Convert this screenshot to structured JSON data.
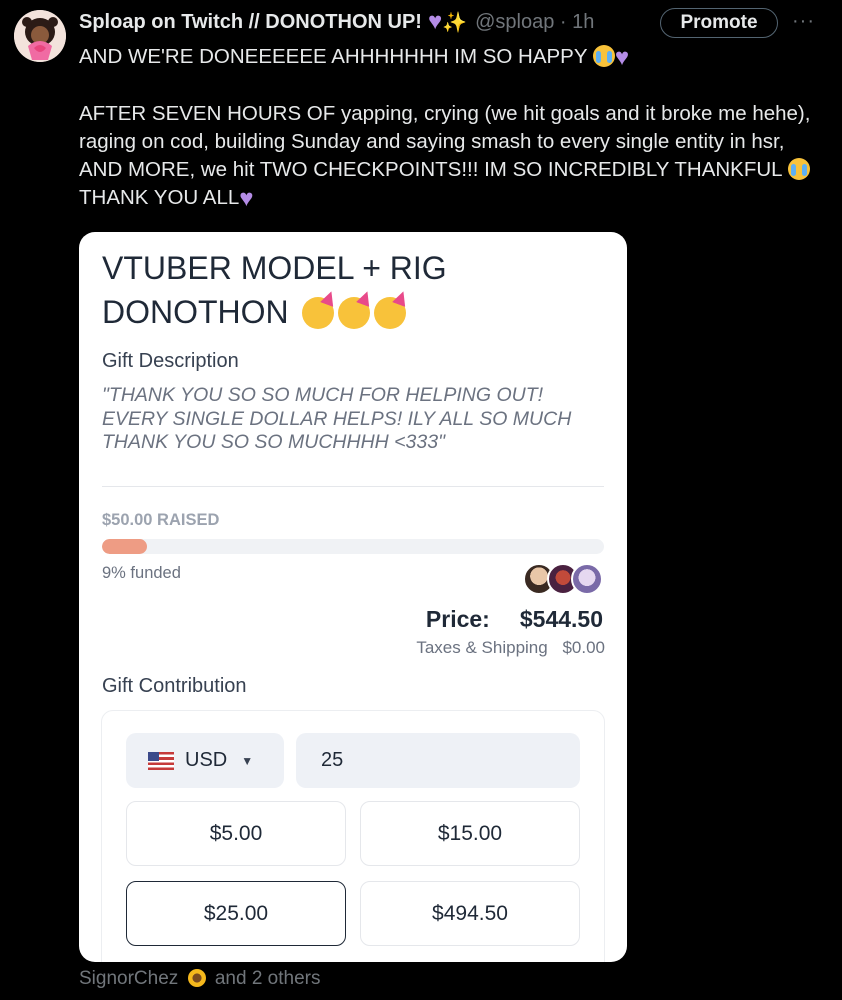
{
  "tweet": {
    "author_name": "Sploap on Twitch // DONOTHON UP!",
    "handle_time": "@sploap · 1h",
    "promote_label": "Promote",
    "more_label": "···",
    "line1": "AND WE'RE DONEEEEEE AHHHHHHH IM SO HAPPY",
    "para2_a": "AFTER SEVEN HOURS OF yapping, crying (we hit goals and it broke me hehe), raging on cod, building Sunday and saying smash to every single entity in hsr, AND MORE, we hit TWO CHECKPOINTS!!! IM SO INCREDIBLY THANKFUL",
    "para2_b": "THANK YOU ALL",
    "liked_by_name": "SignorChez",
    "liked_by_rest": "and 2 others"
  },
  "card": {
    "title": "VTUBER MODEL + RIG DONOTHON",
    "gift_label": "Gift Description",
    "gift_description": "\"THANK YOU SO SO MUCH FOR HELPING OUT! EVERY SINGLE DOLLAR HELPS! ILY ALL SO MUCH THANK YOU SO SO MUCHHHH <333\"",
    "raised_label": "$50.00 RAISED",
    "funded_fraction": 0.09,
    "funded_label": "9% funded",
    "price_label": "Price:",
    "price_value": "$544.50",
    "tax_label": "Taxes & Shipping",
    "tax_value": "$0.00",
    "contribution_label": "Gift Contribution",
    "currency": "USD",
    "amount_value": "25",
    "amount_buttons": [
      "$5.00",
      "$15.00",
      "$25.00",
      "$494.50"
    ],
    "selected_amount": "$25.00"
  },
  "colors": {
    "progress_fill": "#ee9c84",
    "accent_purple": "#b48ce6"
  }
}
